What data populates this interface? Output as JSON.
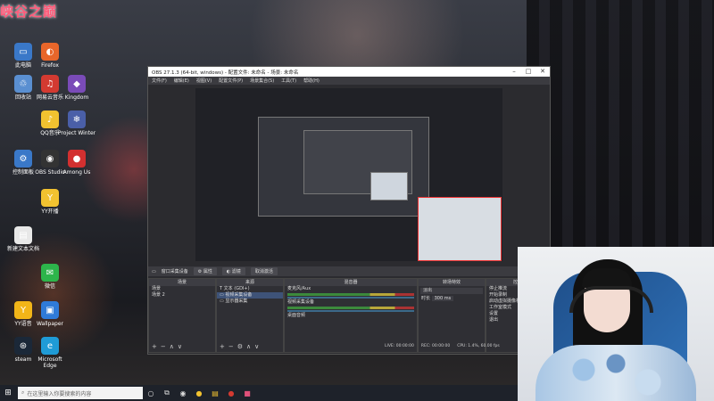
{
  "wallpaper": {
    "title": "峡谷之巅"
  },
  "desktop_icons": [
    {
      "label": "此电脑",
      "icon": "computer-icon",
      "color": "#3a78c8"
    },
    {
      "label": "Firefox",
      "icon": "firefox-icon",
      "color": "#e8662a"
    },
    {
      "label": "网易云音乐",
      "icon": "netease-music-icon",
      "color": "#d33a31"
    },
    {
      "label": "Kingdom",
      "icon": "game-icon",
      "color": "#7a4bb8"
    },
    {
      "label": "回收站",
      "icon": "recycle-bin-icon",
      "color": "#5a8fd1"
    },
    {
      "label": "QQ音乐",
      "icon": "qq-music-icon",
      "color": "#f2c230"
    },
    {
      "label": "Project Winter",
      "icon": "project-winter-icon",
      "color": "#4a5fa8"
    },
    {
      "label": "控制面板",
      "icon": "control-panel-icon",
      "color": "#3a78c8"
    },
    {
      "label": "OBS Studio",
      "icon": "obs-icon",
      "color": "#333333"
    },
    {
      "label": "Among Us",
      "icon": "among-us-icon",
      "color": "#d33030"
    },
    {
      "label": "YY开播",
      "icon": "yy-icon",
      "color": "#f2c230"
    },
    {
      "label": "新建文本文档",
      "icon": "text-file-icon",
      "color": "#e8e8e8"
    },
    {
      "label": "微信",
      "icon": "wechat-icon",
      "color": "#2db54b"
    },
    {
      "label": "YY语音",
      "icon": "yy-voice-icon",
      "color": "#f2b518"
    },
    {
      "label": "Wallpaper",
      "icon": "wallpaper-icon",
      "color": "#2f7bd9"
    },
    {
      "label": "steam",
      "icon": "steam-icon",
      "color": "#1b2838"
    },
    {
      "label": "Microsoft Edge",
      "icon": "edge-icon",
      "color": "#1f9bd6"
    }
  ],
  "obs": {
    "title": "OBS 27.1.3 (64-bit, windows) - 配置文件: 未命名 - 场景: 未命名",
    "menu": [
      "文件(F)",
      "编辑(E)",
      "视图(V)",
      "配置文件(P)",
      "场景集合(S)",
      "工具(T)",
      "帮助(H)"
    ],
    "toolbar": {
      "source_label": "窗口采集设备",
      "properties": "属性",
      "filters": "滤镜",
      "deactivate": "取消激活"
    },
    "docks": {
      "scenes": {
        "header": "场景",
        "items": [
          "场景",
          "场景 2"
        ]
      },
      "sources": {
        "header": "来源",
        "items": [
          "文本 (GDI+)",
          "视频采集设备",
          "显示器采集"
        ]
      },
      "mixer": {
        "header": "混音器",
        "channels": [
          "麦克风/Aux",
          "视频采集设备",
          "桌面音频"
        ]
      },
      "transitions": {
        "header": "转场特效",
        "type": "淡出",
        "duration_label": "时长",
        "duration": "300 ms"
      },
      "controls": {
        "header": "控件",
        "buttons": [
          "停止推流",
          "开始录制",
          "启动虚拟摄像机",
          "工作室模式",
          "设置",
          "退出"
        ]
      }
    },
    "status": {
      "live": "LIVE: 00:00:00",
      "rec": "REC: 00:00:00",
      "cpu": "CPU: 1.4%, 60.00 fps"
    }
  },
  "taskbar": {
    "search_placeholder": "在这里输入你要搜索的内容"
  }
}
